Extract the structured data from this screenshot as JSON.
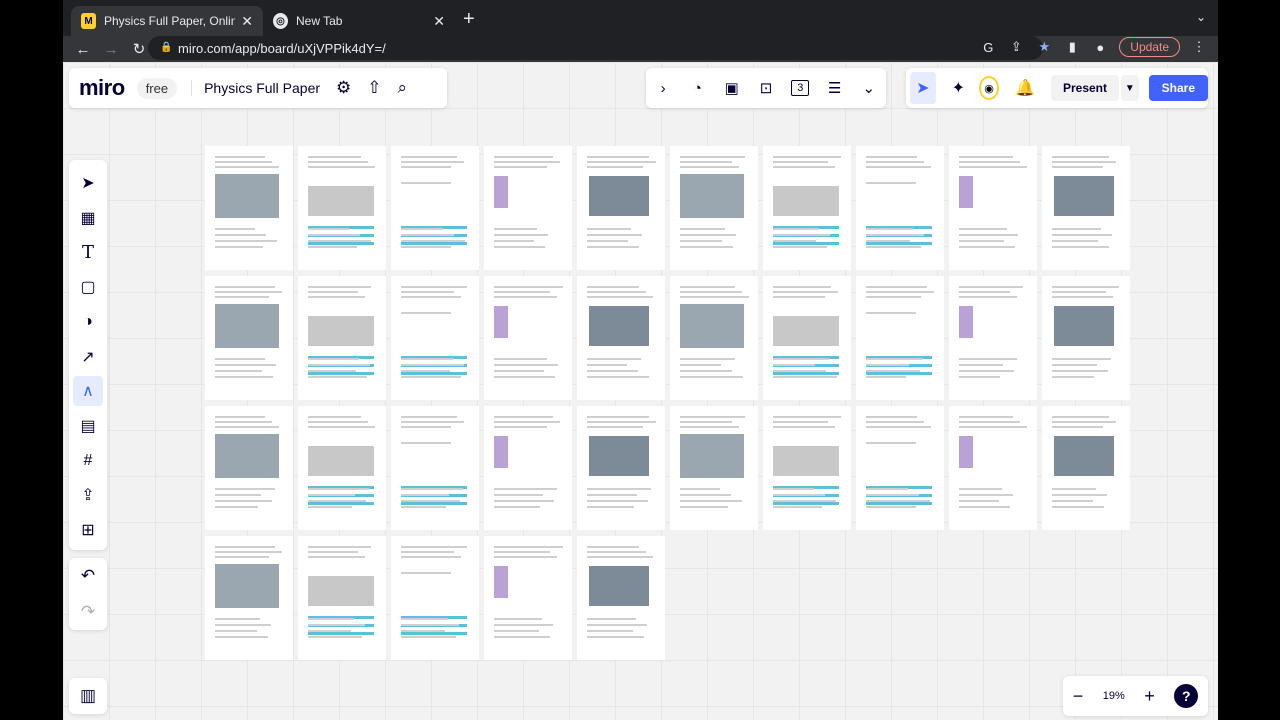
{
  "browser": {
    "tabs": [
      {
        "title": "Physics Full Paper, Online Whi",
        "active": true
      },
      {
        "title": "New Tab",
        "active": false
      }
    ],
    "url": "miro.com/app/board/uXjVPPik4dY=/",
    "update_label": "Update"
  },
  "board": {
    "logo": "miro",
    "plan": "free",
    "title": "Physics Full Paper",
    "present_label": "Present",
    "share_label": "Share",
    "timer_badge": "3",
    "zoom_level": "19%",
    "help": "?"
  },
  "left_tools": [
    "select",
    "templates",
    "text",
    "sticky-note",
    "shapes",
    "connection-line",
    "pen",
    "comment",
    "frame",
    "upload",
    "more-apps"
  ],
  "frames_count": 35,
  "colors": {
    "accent": "#4262ff",
    "miro_dark": "#050038",
    "canvas": "#f2f2f2"
  }
}
